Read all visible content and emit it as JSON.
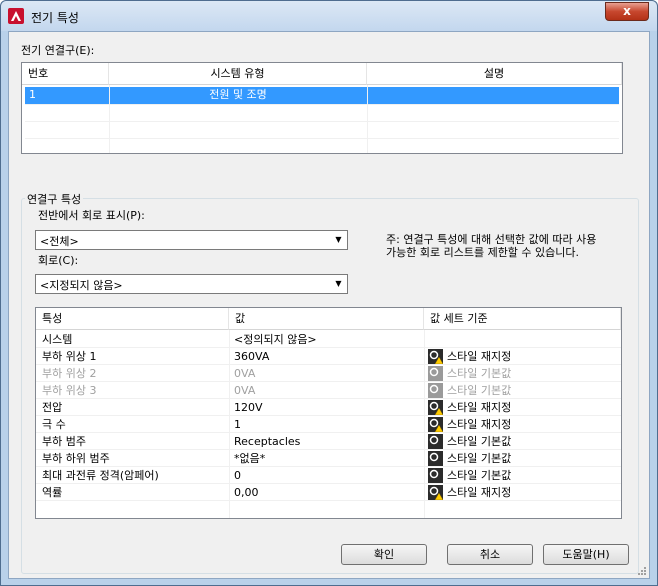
{
  "window": {
    "title": "전기 특성",
    "close_glyph": "x"
  },
  "connectors": {
    "label": "전기 연결구(E):",
    "columns": [
      "번호",
      "시스템 유형",
      "설명"
    ],
    "rows": [
      {
        "number": "1",
        "system_type": "전원 및 조명",
        "description": ""
      }
    ]
  },
  "connector_props": {
    "group_label": "연결구 특성",
    "panel_label": "전반에서 회로 표시(P):",
    "panel_value": "<전체>",
    "circuit_label": "회로(C):",
    "circuit_value": "<지정되지 않음>",
    "note": "주: 연결구 특성에 대해 선택한 값에 따라 사용 가능한 회로 리스트를 제한할 수 있습니다."
  },
  "properties": {
    "columns": [
      "특성",
      "값",
      "값 세트 기준"
    ],
    "rows": [
      {
        "name": "시스템",
        "value": "<정의되지 않음>",
        "basis": "",
        "icon": "",
        "disabled": false
      },
      {
        "name": "부하 위상 1",
        "value": "360VA",
        "basis": "스타일 재지정",
        "icon": "style-override-icon",
        "disabled": false
      },
      {
        "name": "부하 위상 2",
        "value": "0VA",
        "basis": "스타일 기본값",
        "icon": "style-default-icon",
        "disabled": true
      },
      {
        "name": "부하 위상 3",
        "value": "0VA",
        "basis": "스타일 기본값",
        "icon": "style-default-icon",
        "disabled": true
      },
      {
        "name": "전압",
        "value": "120V",
        "basis": "스타일 재지정",
        "icon": "style-override-icon",
        "disabled": false
      },
      {
        "name": "극 수",
        "value": "1",
        "basis": "스타일 재지정",
        "icon": "style-override-icon",
        "disabled": false
      },
      {
        "name": "부하 범주",
        "value": "Receptacles",
        "basis": "스타일 기본값",
        "icon": "style-default-icon",
        "disabled": false
      },
      {
        "name": "부하 하위 범주",
        "value": "*없음*",
        "basis": "스타일 기본값",
        "icon": "style-default-icon",
        "disabled": false
      },
      {
        "name": "최대 과전류 정격(암페어)",
        "value": "0",
        "basis": "스타일 기본값",
        "icon": "style-default-icon",
        "disabled": false
      },
      {
        "name": "역률",
        "value": "0,00",
        "basis": "스타일 재지정",
        "icon": "style-override-icon",
        "disabled": false
      }
    ]
  },
  "buttons": {
    "ok": "확인",
    "cancel": "취소",
    "help": "도움말(H)"
  },
  "colors": {
    "selection": "#3399ff",
    "dialog_bg": "#f0f0f0",
    "frame": "#b9d1ea",
    "disabled_text": "#a0a0a0"
  }
}
